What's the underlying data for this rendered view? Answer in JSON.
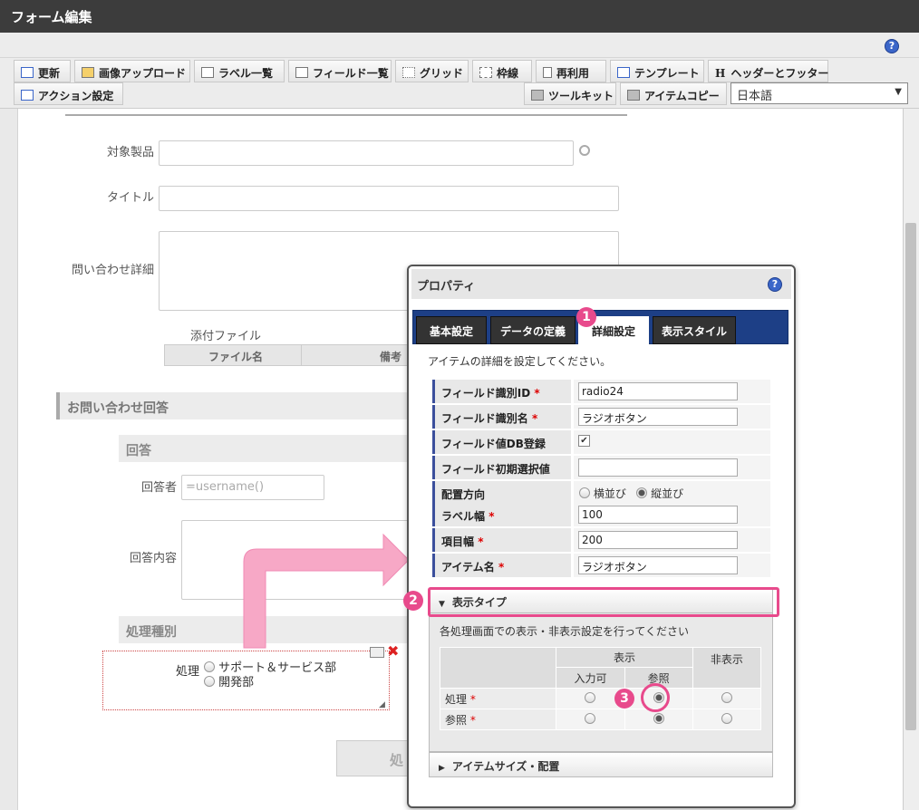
{
  "title": "フォーム編集",
  "help_icon": "?",
  "toolbar": {
    "row1": [
      "更新",
      "画像アップロード",
      "ラベル一覧",
      "フィールド一覧",
      "グリッド",
      "枠線",
      "再利用",
      "テンプレート",
      "ヘッダーとフッター"
    ],
    "action": "アクション設定",
    "toolkit": "ツールキット",
    "item_copy": "アイテムコピー",
    "header_mark": "H",
    "language": "日本語"
  },
  "form": {
    "target_product": "対象製品",
    "title": "タイトル",
    "inquiry_detail": "問い合わせ詳細",
    "attach_label": "添付ファイル",
    "attach_col1": "ファイル名",
    "attach_col2": "備考",
    "answer_section": "お問い合わせ回答",
    "answer_sub": "回答",
    "responder": "回答者",
    "responder_value": "=username()",
    "answer_content": "回答内容",
    "process_type": "処理種別",
    "radio_label": "処理",
    "radio_opts": [
      "サポート＆サービス部",
      "開発部"
    ],
    "bottom_btn": "処"
  },
  "panel": {
    "title": "プロパティ",
    "tabs": [
      "基本設定",
      "データの定義",
      "詳細設定",
      "表示スタイル"
    ],
    "desc": "アイテムの詳細を設定してください。",
    "rows": [
      {
        "k": "フィールド識別ID",
        "req": "*",
        "v": "radio24"
      },
      {
        "k": "フィールド識別名",
        "req": "*",
        "v": "ラジオボタン"
      },
      {
        "k": "フィールド値DB登録",
        "req": "",
        "v": "✔"
      },
      {
        "k": "フィールド初期選択値",
        "req": "",
        "v": ""
      },
      {
        "k": "配置方向",
        "req": "",
        "v": ""
      },
      {
        "k": "ラベル幅",
        "req": "*",
        "v": "100"
      },
      {
        "k": "項目幅",
        "req": "*",
        "v": "200"
      },
      {
        "k": "アイテム名",
        "req": "*",
        "v": "ラジオボタン"
      }
    ],
    "orient_opts": [
      "横並び",
      "縦並び"
    ],
    "display_type": "表示タイプ",
    "display_desc": "各処理画面での表示・非表示設定を行ってください",
    "tbl_h_show": "表示",
    "tbl_h_hide": "非表示",
    "tbl_h_input": "入力可",
    "tbl_h_ref": "参照",
    "tbl_rows": [
      "処理",
      "参照"
    ],
    "tbl_req": "*",
    "size_section": "アイテムサイズ・配置"
  },
  "callouts": [
    "1",
    "2",
    "3"
  ],
  "colors": {
    "accent": "#e84a8c",
    "tab_bar": "#1d3f86"
  }
}
